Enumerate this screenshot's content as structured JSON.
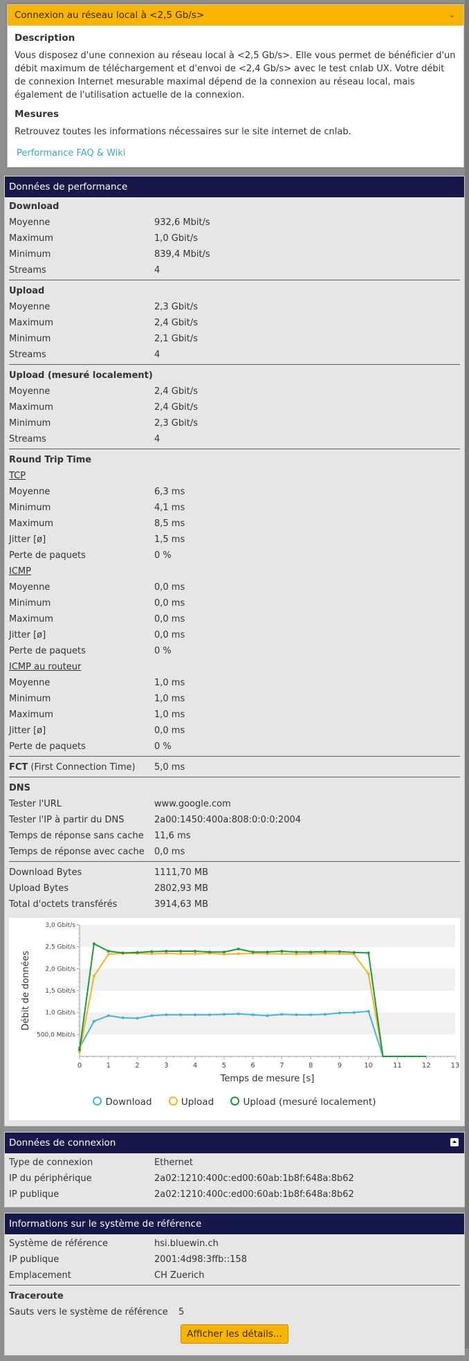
{
  "accordion": {
    "title": "Connexion au réseau local à <2,5 Gb/s>",
    "description_heading": "Description",
    "description_text": "Vous disposez d'une connexion au réseau local à <2,5 Gb/s>. Elle vous permet de bénéficier d'un débit maximum de téléchargement et d'envoi de <2,4 Gb/s> avec le test cnlab UX. Votre débit de connexion Internet mesurable maximal dépend de la connexion au réseau local, mais également de l'utilisation actuelle de la connexion.",
    "measures_heading": "Mesures",
    "measures_text": "Retrouvez toutes les informations nécessaires sur le site internet de cnlab.",
    "link": "Performance FAQ & Wiki",
    "chevron_icon": "chevron-down-icon"
  },
  "performance": {
    "title": "Données de performance",
    "download": {
      "title": "Download",
      "rows": [
        {
          "k": "Moyenne",
          "v": "932,6 Mbit/s"
        },
        {
          "k": "Maximum",
          "v": "1,0 Gbit/s"
        },
        {
          "k": "Minimum",
          "v": "839,4 Mbit/s"
        },
        {
          "k": "Streams",
          "v": "4"
        }
      ]
    },
    "upload": {
      "title": "Upload",
      "rows": [
        {
          "k": "Moyenne",
          "v": "2,3 Gbit/s"
        },
        {
          "k": "Maximum",
          "v": "2,4 Gbit/s"
        },
        {
          "k": "Minimum",
          "v": "2,1 Gbit/s"
        },
        {
          "k": "Streams",
          "v": "4"
        }
      ]
    },
    "upload_local": {
      "title": "Upload (mesuré localement)",
      "rows": [
        {
          "k": "Moyenne",
          "v": "2,4 Gbit/s"
        },
        {
          "k": "Maximum",
          "v": "2,4 Gbit/s"
        },
        {
          "k": "Minimum",
          "v": "2,3 Gbit/s"
        },
        {
          "k": "Streams",
          "v": "4"
        }
      ]
    },
    "rtt": {
      "title": "Round Trip Time",
      "tcp_title": "TCP",
      "tcp_rows": [
        {
          "k": "Moyenne",
          "v": "6,3 ms"
        },
        {
          "k": "Minimum",
          "v": "4,1 ms"
        },
        {
          "k": "Maximum",
          "v": "8,5 ms"
        },
        {
          "k": "Jitter [ø]",
          "v": "1,5 ms"
        },
        {
          "k": "Perte de paquets",
          "v": "0 %"
        }
      ],
      "icmp_title": "ICMP",
      "icmp_rows": [
        {
          "k": "Moyenne",
          "v": "0,0 ms"
        },
        {
          "k": "Minimum",
          "v": "0,0 ms"
        },
        {
          "k": "Maximum",
          "v": "0,0 ms"
        },
        {
          "k": "Jitter [ø]",
          "v": "0,0 ms"
        },
        {
          "k": "Perte de paquets",
          "v": "0 %"
        }
      ],
      "router_title": "ICMP au routeur",
      "router_rows": [
        {
          "k": "Moyenne",
          "v": "1,0 ms"
        },
        {
          "k": "Minimum",
          "v": "1,0 ms"
        },
        {
          "k": "Maximum",
          "v": "1,0 ms"
        },
        {
          "k": "Jitter [ø]",
          "v": "0,0 ms"
        },
        {
          "k": "Perte de paquets",
          "v": "0 %"
        }
      ]
    },
    "fct": {
      "k_bold": "FCT",
      "k_rest": " (First Connection Time)",
      "v": "5,0 ms"
    },
    "dns": {
      "title": "DNS",
      "rows": [
        {
          "k": "Tester l'URL",
          "v": "www.google.com"
        },
        {
          "k": "Tester l'IP à partir du DNS",
          "v": "2a00:1450:400a:808:0:0:0:2004"
        },
        {
          "k": "Temps de réponse sans cache",
          "v": "11,6 ms"
        },
        {
          "k": "Temps de réponse avec cache",
          "v": "0,0 ms"
        }
      ]
    },
    "bytes": {
      "rows": [
        {
          "k": "Download Bytes",
          "v": "1111,70 MB"
        },
        {
          "k": "Upload Bytes",
          "v": "2802,93 MB"
        },
        {
          "k": "Total d'octets transférés",
          "v": "3914,63 MB"
        }
      ]
    }
  },
  "chart_data": {
    "type": "line",
    "xlabel": "Temps de mesure [s]",
    "ylabel": "Débit de données",
    "xlim": [
      0,
      13
    ],
    "ylim": [
      0,
      3.0
    ],
    "x_ticks": [
      "0",
      "1",
      "2",
      "3",
      "4",
      "5",
      "6",
      "7",
      "8",
      "9",
      "10",
      "11",
      "12",
      "13"
    ],
    "y_ticks": [
      {
        "v": 0.5,
        "label": "500,0 Mbit/s"
      },
      {
        "v": 1.0,
        "label": "1,0 Gbit/s"
      },
      {
        "v": 1.5,
        "label": "1,5 Gbit/s"
      },
      {
        "v": 2.0,
        "label": "2,0 Gbit/s"
      },
      {
        "v": 2.5,
        "label": "2,5 Gbit/s"
      },
      {
        "v": 3.0,
        "label": "3,0 Gbit/s"
      }
    ],
    "grid": true,
    "legend_position": "bottom",
    "series": [
      {
        "name": "Download",
        "color": "#41b6d8",
        "x": [
          0,
          0.5,
          1,
          1.5,
          2,
          2.5,
          3,
          3.5,
          4,
          4.5,
          5,
          5.5,
          6,
          6.5,
          7,
          7.5,
          8,
          8.5,
          9,
          9.5,
          10,
          10.5,
          11,
          11.5,
          12
        ],
        "y": [
          0.2,
          0.8,
          0.93,
          0.88,
          0.87,
          0.93,
          0.95,
          0.95,
          0.95,
          0.95,
          0.96,
          0.97,
          0.95,
          0.93,
          0.96,
          0.95,
          0.95,
          0.96,
          0.99,
          1.0,
          1.03,
          0,
          0,
          0,
          0
        ]
      },
      {
        "name": "Upload",
        "color": "#f5b324",
        "x": [
          0,
          0.5,
          1,
          1.5,
          2,
          2.5,
          3,
          3.5,
          4,
          4.5,
          5,
          5.5,
          6,
          6.5,
          7,
          7.5,
          8,
          8.5,
          9,
          9.5,
          10,
          10.5,
          11,
          11.5,
          12
        ],
        "y": [
          0.1,
          1.83,
          2.33,
          2.35,
          2.35,
          2.34,
          2.35,
          2.34,
          2.34,
          2.35,
          2.33,
          2.34,
          2.35,
          2.34,
          2.34,
          2.33,
          2.34,
          2.35,
          2.34,
          2.33,
          1.88,
          0,
          0,
          0,
          0
        ]
      },
      {
        "name": "Upload (mesuré localement)",
        "color": "#1a9a3a",
        "x": [
          0,
          0.5,
          1,
          1.5,
          2,
          2.5,
          3,
          3.5,
          4,
          4.5,
          5,
          5.5,
          6,
          6.5,
          7,
          7.5,
          8,
          8.5,
          9,
          9.5,
          10,
          10.5,
          11,
          11.5,
          12
        ],
        "y": [
          0.15,
          2.57,
          2.4,
          2.36,
          2.37,
          2.39,
          2.4,
          2.4,
          2.4,
          2.38,
          2.38,
          2.45,
          2.38,
          2.38,
          2.4,
          2.38,
          2.38,
          2.39,
          2.39,
          2.37,
          2.36,
          0,
          0,
          0,
          0
        ]
      }
    ]
  },
  "connection": {
    "title": "Données de connexion",
    "collapse_icon": "collapse-icon",
    "rows": [
      {
        "k": "Type de connexion",
        "v": "Ethernet"
      },
      {
        "k": "IP du périphérique",
        "v": "2a02:1210:400c:ed00:60ab:1b8f:648a:8b62"
      },
      {
        "k": "IP publique",
        "v": "2a02:1210:400c:ed00:60ab:1b8f:648a:8b62"
      }
    ]
  },
  "reference": {
    "title": "Informations sur le système de référence",
    "rows": [
      {
        "k": "Système de référence",
        "v": "hsi.bluewin.ch"
      },
      {
        "k": "IP publique",
        "v": "2001:4d98:3ffb::158"
      },
      {
        "k": "Emplacement",
        "v": "CH Zuerich"
      }
    ],
    "traceroute_title": "Traceroute",
    "hops": {
      "k": "Sauts vers le système de référence",
      "v": "5"
    },
    "details_button": "Afficher les détails..."
  }
}
